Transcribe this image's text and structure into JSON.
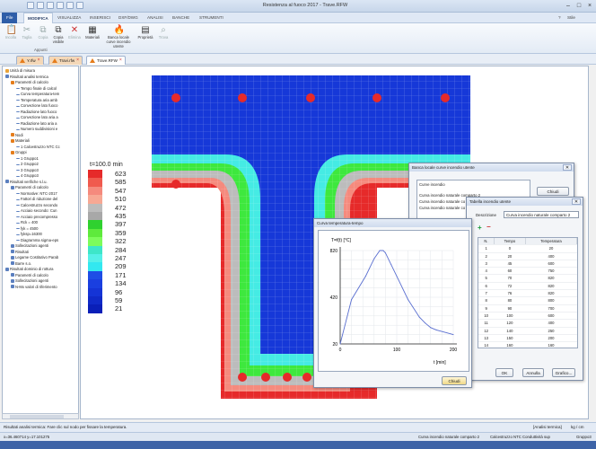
{
  "window": {
    "title": "Resistenza al fuoco 2017 - Trave.RFW"
  },
  "ribbon_tabs": [
    "File",
    "MODIFICA",
    "VISUALIZZA",
    "INSERISCI",
    "DXF/DWG",
    "ANALISI",
    "BANCHE",
    "STRUMENTI"
  ],
  "help_label": "Stile",
  "ribbon": {
    "buttons": [
      "Incolla",
      "Taglia",
      "Copia",
      "Copia visibile",
      "Elimina",
      "Materiali",
      "Banca locale curve incendio utente",
      "Proprietà",
      "Trova"
    ],
    "group_appunti": "Appunti"
  },
  "doc_tabs": [
    "Y.rfw",
    "Travi.rfw",
    "Trave.RFW"
  ],
  "tree": [
    {
      "label": "Unità di misura",
      "level": 0,
      "color": "#e8a33a"
    },
    {
      "label": "Risultati analisi termica",
      "level": 0,
      "color": "#5b7fbf"
    },
    {
      "label": "Parametri di calcolo",
      "level": 1,
      "color": "#e57d1c"
    },
    {
      "label": "Tempo finale di calcol",
      "level": 2,
      "color": ""
    },
    {
      "label": "Curva temperatura-tem",
      "level": 2,
      "color": ""
    },
    {
      "label": "Temperatura aria amb",
      "level": 2,
      "color": ""
    },
    {
      "label": "Convezione lato fuoco",
      "level": 2,
      "color": ""
    },
    {
      "label": "Radiazione lato fuoco",
      "level": 2,
      "color": ""
    },
    {
      "label": "Convezione lato aria a",
      "level": 2,
      "color": ""
    },
    {
      "label": "Radiazione lato aria a",
      "level": 2,
      "color": ""
    },
    {
      "label": "Numero suddivisioni e",
      "level": 2,
      "color": ""
    },
    {
      "label": "Nodi",
      "level": 1,
      "color": "#e57d1c"
    },
    {
      "label": "Materiali",
      "level": 1,
      "color": "#e57d1c"
    },
    {
      "label": "1  Calcestruzzo NTC Cc",
      "level": 2,
      "color": ""
    },
    {
      "label": "Gruppi",
      "level": 1,
      "color": "#e57d1c"
    },
    {
      "label": "1  Gruppo1",
      "level": 2,
      "color": ""
    },
    {
      "label": "2  Gruppo2",
      "level": 2,
      "color": ""
    },
    {
      "label": "3  Gruppo3",
      "level": 2,
      "color": ""
    },
    {
      "label": "4  Gruppo3",
      "level": 2,
      "color": ""
    },
    {
      "label": "Risultati verifiche s.l.u.",
      "level": 0,
      "color": "#5b7fbf"
    },
    {
      "label": "Parametri di calcolo",
      "level": 1,
      "color": "#5b7fbf"
    },
    {
      "label": "Normative: NTC-2017",
      "level": 2,
      "color": ""
    },
    {
      "label": "Fattori di riduzione del",
      "level": 2,
      "color": ""
    },
    {
      "label": "Calcestruzzo secondo",
      "level": 2,
      "color": ""
    },
    {
      "label": "Acciaio secondo: Cun",
      "level": 2,
      "color": ""
    },
    {
      "label": "Acciaio precompresso",
      "level": 2,
      "color": ""
    },
    {
      "label": "Rck = 400",
      "level": 2,
      "color": ""
    },
    {
      "label": "fyk = 4500",
      "level": 2,
      "color": ""
    },
    {
      "label": "fyksp=16300",
      "level": 2,
      "color": ""
    },
    {
      "label": "Diagramma sigma-eps",
      "level": 2,
      "color": ""
    },
    {
      "label": "Sollecitazioni agenti",
      "level": 1,
      "color": "#5b7fbf"
    },
    {
      "label": "Risultati",
      "level": 1,
      "color": "#5b7fbf"
    },
    {
      "label": "Legame Costitutivo Parab",
      "level": 1,
      "color": "#5b7fbf"
    },
    {
      "label": "Barre s.o.",
      "level": 1,
      "color": "#5b7fbf"
    },
    {
      "label": "Risultati dominio di rottura",
      "level": 0,
      "color": "#5b7fbf"
    },
    {
      "label": "Parametri di calcolo",
      "level": 1,
      "color": "#5b7fbf"
    },
    {
      "label": "Sollecitazioni agenti",
      "level": 1,
      "color": "#5b7fbf"
    },
    {
      "label": "N-Mx valori di riferimento",
      "level": 1,
      "color": "#5b7fbf"
    }
  ],
  "legend": {
    "title": "t=100.0 min",
    "levels": [
      {
        "value": "623",
        "color": "#e62a2a"
      },
      {
        "value": "585",
        "color": "#f05a4e"
      },
      {
        "value": "547",
        "color": "#f58a7d"
      },
      {
        "value": "510",
        "color": "#f7a894"
      },
      {
        "value": "472",
        "color": "#bcbcbc"
      },
      {
        "value": "435",
        "color": "#a8a8a8"
      },
      {
        "value": "397",
        "color": "#2fd12f"
      },
      {
        "value": "359",
        "color": "#5eea3c"
      },
      {
        "value": "322",
        "color": "#7dfc5b"
      },
      {
        "value": "284",
        "color": "#3ee6c9"
      },
      {
        "value": "247",
        "color": "#55f0e8"
      },
      {
        "value": "209",
        "color": "#33e8f0"
      },
      {
        "value": "171",
        "color": "#1e4de6"
      },
      {
        "value": "134",
        "color": "#1a3fe0"
      },
      {
        "value": "96",
        "color": "#1534d6"
      },
      {
        "value": "59",
        "color": "#102ac8"
      },
      {
        "value": "21",
        "color": "#0a1fb8"
      }
    ]
  },
  "dialog_banca": {
    "title": "Banca locale curve incendio utente",
    "list_header": "Curve incendio",
    "items": [
      "Curva incendio naturale comparto 2",
      "Curva incendio naturale co",
      "Curva incendio naturale co"
    ],
    "close_label": "Chiudi"
  },
  "dialog_tabella": {
    "title": "Tabella incendio utente",
    "desc_label": "Descrizione",
    "desc_value": "Curva incendio naturale comparto 2",
    "col_n": "N.",
    "col_time": "Tempo",
    "col_temp": "Temperatura",
    "rows": [
      [
        "1",
        "0",
        "20"
      ],
      [
        "2",
        "20",
        "400"
      ],
      [
        "3",
        "45",
        "600"
      ],
      [
        "4",
        "60",
        "750"
      ],
      [
        "5",
        "70",
        "820"
      ],
      [
        "6",
        "72",
        "820"
      ],
      [
        "7",
        "76",
        "820"
      ],
      [
        "8",
        "80",
        "800"
      ],
      [
        "9",
        "90",
        "700"
      ],
      [
        "10",
        "100",
        "600"
      ],
      [
        "11",
        "120",
        "400"
      ],
      [
        "12",
        "140",
        "250"
      ],
      [
        "13",
        "150",
        "200"
      ],
      [
        "14",
        "160",
        "160"
      ],
      [
        "15",
        "170",
        "140"
      ],
      [
        "16",
        "200",
        "100"
      ]
    ],
    "ok_label": "OK",
    "cancel_label": "Annulla",
    "graph_label": "Grafico..."
  },
  "dialog_curva": {
    "title": "Curva temperatura-tempo",
    "ylabel": "T=f(t) [°C]",
    "xlabel": "t [min]",
    "close_label": "Chiudi"
  },
  "chart_data": {
    "type": "line",
    "title": "",
    "xlabel": "t [min]",
    "ylabel": "T=f(t) [°C]",
    "x": [
      0,
      20,
      45,
      60,
      70,
      72,
      76,
      80,
      90,
      100,
      120,
      140,
      150,
      160,
      170,
      200
    ],
    "series": [
      {
        "values": [
          20,
          400,
          600,
          750,
          820,
          820,
          820,
          800,
          700,
          600,
          400,
          250,
          200,
          160,
          140,
          100
        ]
      }
    ],
    "xlim": [
      0,
      200
    ],
    "ylim": [
      20,
      820
    ],
    "xticks": [
      "0",
      "100",
      "200"
    ],
    "yticks": [
      "20",
      "420",
      "820"
    ],
    "grid": true
  },
  "status": {
    "message": "Risultati analisi termica: Fare clic sul nodo per fissare la temperatura.",
    "mode": "[Analisi termica]",
    "units": "kg / cm",
    "coords": "x=36.460714 y=17.101275",
    "curve": "Curva incendio naturale comparto 2",
    "material": "Calcestruzzo NTC Conduttività sup",
    "group": "Gruppo3"
  }
}
